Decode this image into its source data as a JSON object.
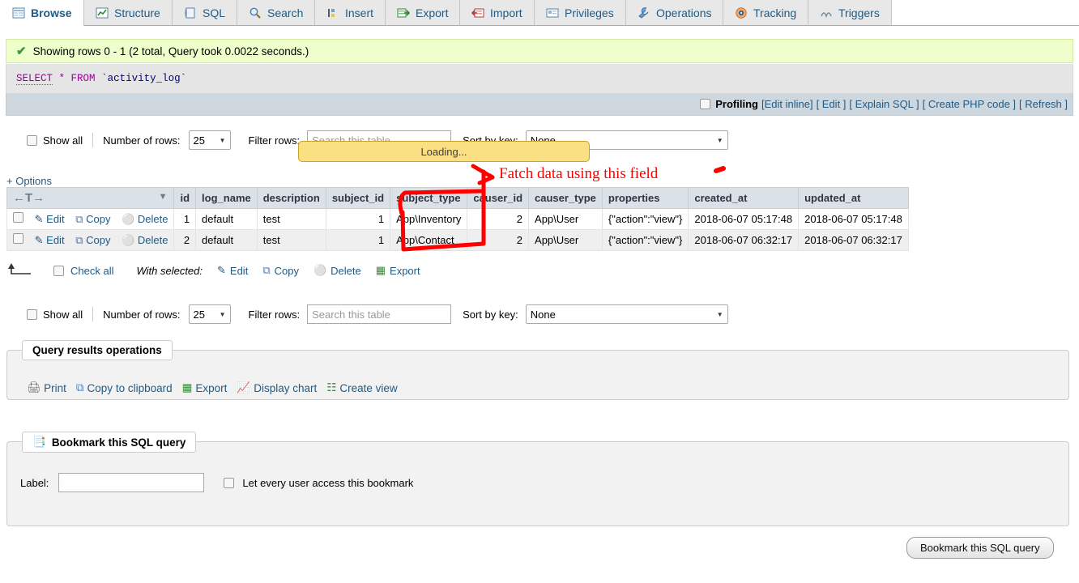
{
  "tabs": [
    {
      "label": "Browse",
      "icon": "browse-icon",
      "active": true
    },
    {
      "label": "Structure",
      "icon": "structure-icon",
      "active": false
    },
    {
      "label": "SQL",
      "icon": "sql-icon",
      "active": false
    },
    {
      "label": "Search",
      "icon": "search-icon",
      "active": false
    },
    {
      "label": "Insert",
      "icon": "insert-icon",
      "active": false
    },
    {
      "label": "Export",
      "icon": "export-icon",
      "active": false
    },
    {
      "label": "Import",
      "icon": "import-icon",
      "active": false
    },
    {
      "label": "Privileges",
      "icon": "privileges-icon",
      "active": false
    },
    {
      "label": "Operations",
      "icon": "operations-icon",
      "active": false
    },
    {
      "label": "Tracking",
      "icon": "tracking-icon",
      "active": false
    },
    {
      "label": "Triggers",
      "icon": "triggers-icon",
      "active": false
    }
  ],
  "success": {
    "message": "Showing rows 0 - 1 (2 total, Query took 0.0022 seconds.)"
  },
  "sql": {
    "keyword_select": "SELECT",
    "star_from": "* FROM",
    "table": "`activity_log`"
  },
  "action_strip": {
    "profiling_label": "Profiling",
    "links": [
      "[Edit inline]",
      "[ Edit ]",
      "[ Explain SQL ]",
      "[ Create PHP code ]",
      "[ Refresh ]"
    ]
  },
  "filter_top": {
    "show_all": "Show all",
    "number_of_rows_label": "Number of rows:",
    "rows_value": "25",
    "filter_rows_label": "Filter rows:",
    "filter_placeholder": "Search this table",
    "sort_by_key_label": "Sort by key:",
    "sort_value": "None"
  },
  "filter_bottom": {
    "show_all": "Show all",
    "number_of_rows_label": "Number of rows:",
    "rows_value": "25",
    "filter_rows_label": "Filter rows:",
    "filter_placeholder": "Search this table",
    "sort_by_key_label": "Sort by key:",
    "sort_value": "None"
  },
  "options_link": "+ Options",
  "table": {
    "action_labels": {
      "edit": "Edit",
      "copy": "Copy",
      "delete": "Delete"
    },
    "columns": [
      "id",
      "log_name",
      "description",
      "subject_id",
      "subject_type",
      "causer_id",
      "causer_type",
      "properties",
      "created_at",
      "updated_at"
    ],
    "rows": [
      {
        "id": "1",
        "log_name": "default",
        "description": "test",
        "subject_id": "1",
        "subject_type": "App\\Inventory",
        "causer_id": "2",
        "causer_type": "App\\User",
        "properties": "{\"action\":\"view\"}",
        "created_at": "2018-06-07 05:17:48",
        "updated_at": "2018-06-07 05:17:48"
      },
      {
        "id": "2",
        "log_name": "default",
        "description": "test",
        "subject_id": "1",
        "subject_type": "App\\Contact",
        "causer_id": "2",
        "causer_type": "App\\User",
        "properties": "{\"action\":\"view\"}",
        "created_at": "2018-06-07 06:32:17",
        "updated_at": "2018-06-07 06:32:17"
      }
    ]
  },
  "with_selected": {
    "check_all": "Check all",
    "label": "With selected:",
    "edit": "Edit",
    "copy": "Copy",
    "delete": "Delete",
    "export": "Export"
  },
  "query_results_operations": {
    "legend": "Query results operations",
    "items": [
      {
        "label": "Print",
        "icon": "print-icon"
      },
      {
        "label": "Copy to clipboard",
        "icon": "copy-icon"
      },
      {
        "label": "Export",
        "icon": "export-icon"
      },
      {
        "label": "Display chart",
        "icon": "chart-icon"
      },
      {
        "label": "Create view",
        "icon": "create-view-icon"
      }
    ]
  },
  "bookmark": {
    "legend": "Bookmark this SQL query",
    "label_text": "Label:",
    "label_value": "",
    "checkbox_text": "Let every user access this bookmark",
    "submit": "Bookmark this SQL query"
  },
  "loading": {
    "text": "Loading..."
  },
  "annotation": {
    "text": "Fatch data using this field",
    "color": "#ff0000"
  },
  "colors": {
    "accent_link": "#235a81",
    "success_bg": "#eeffcc",
    "tooltip_bg": "#fbdf83",
    "table_header_bg": "#dae2e8",
    "annotation": "#ff0000"
  }
}
